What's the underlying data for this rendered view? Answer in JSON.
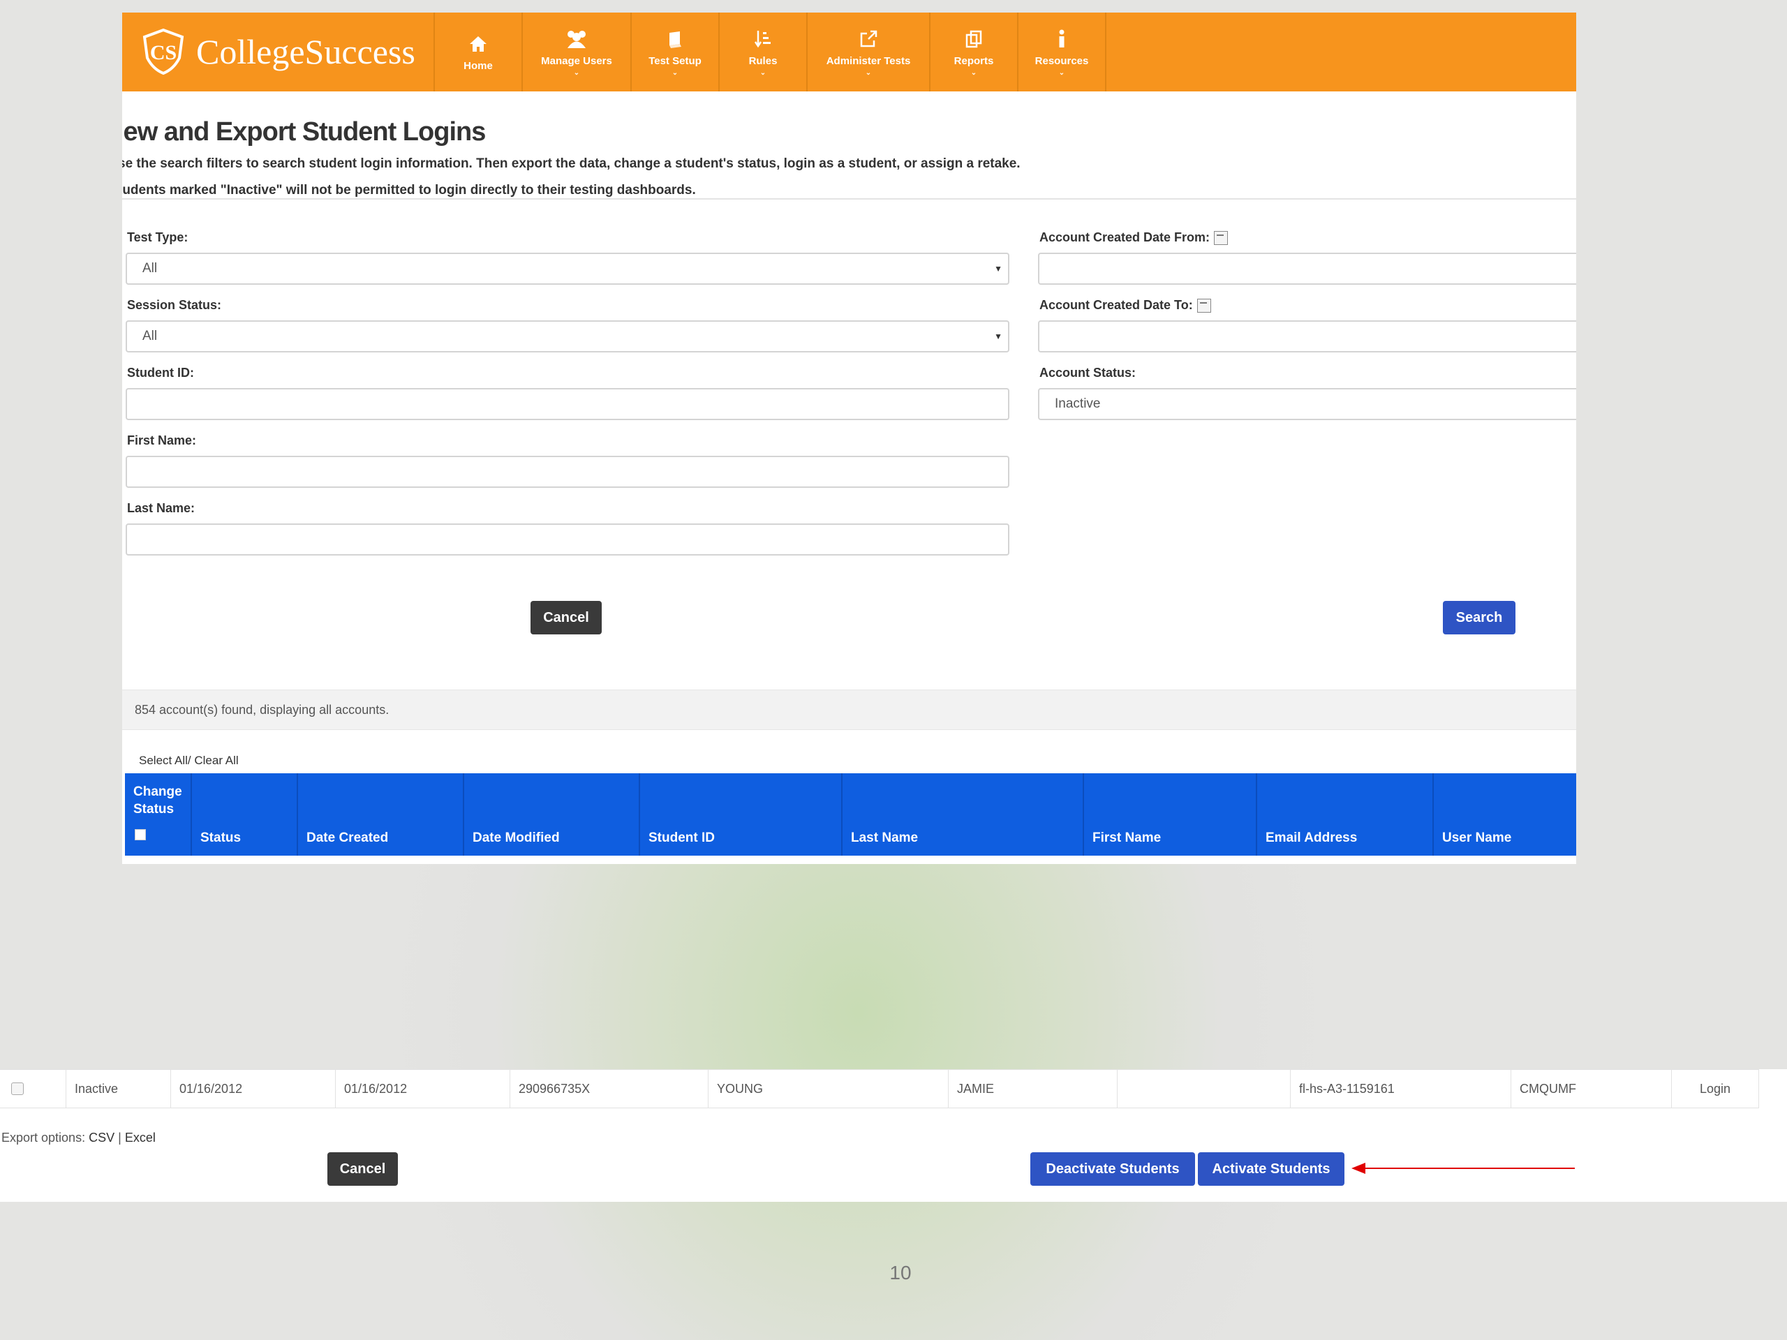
{
  "brand": {
    "name": "CollegeSuccess",
    "logo_icon": "cs-shield-logo"
  },
  "colors": {
    "nav": "#f7941d",
    "table_header": "#0f5ee0",
    "primary_button": "#2e54c4",
    "dark_button": "#3a3a3a",
    "arrow": "#e00000"
  },
  "nav": {
    "items": [
      {
        "label": "Home",
        "icon": "home-icon"
      },
      {
        "label": "Manage Users",
        "icon": "users-icon"
      },
      {
        "label": "Test Setup",
        "icon": "book-icon"
      },
      {
        "label": "Rules",
        "icon": "sort-icon"
      },
      {
        "label": "Administer Tests",
        "icon": "external-link-icon"
      },
      {
        "label": "Reports",
        "icon": "reports-icon"
      },
      {
        "label": "Resources",
        "icon": "info-icon"
      }
    ]
  },
  "page": {
    "title": "iew and Export Student Logins",
    "intro1": "se the search filters to search student login information. Then export the data, change a student's status, login as a student, or assign a retake.",
    "intro2": "tudents marked \"Inactive\" will not be permitted to login directly to their testing dashboards."
  },
  "filters": {
    "test_type": {
      "label": "Test Type:",
      "value": "All"
    },
    "session_status": {
      "label": "Session Status:",
      "value": "All"
    },
    "student_id": {
      "label": "Student ID:",
      "value": ""
    },
    "first_name": {
      "label": "First Name:",
      "value": ""
    },
    "last_name": {
      "label": "Last Name:",
      "value": ""
    },
    "created_from": {
      "label": "Account Created Date From:",
      "value": ""
    },
    "created_to": {
      "label": "Account Created Date To:",
      "value": ""
    },
    "account_status": {
      "label": "Account Status:",
      "value": "Inactive"
    }
  },
  "actions": {
    "cancel": "Cancel",
    "search": "Search"
  },
  "results": {
    "summary": "854 account(s) found, displaying all accounts.",
    "select_all": "Select All/ Clear All"
  },
  "table": {
    "headers": [
      "Change Status",
      "Status",
      "Date Created",
      "Date Modified",
      "Student ID",
      "Last Name",
      "First Name",
      "Email Address",
      "User Name"
    ],
    "rows": [
      {
        "status": "Inactive",
        "date_created": "01/16/2012",
        "date_modified": "01/16/2012",
        "student_id": "290966735X",
        "last_name": "YOUNG",
        "first_name": "JAMIE",
        "email": "",
        "username": "fl-hs-A3-1159161",
        "password": "CMQUMF",
        "action": "Login"
      }
    ]
  },
  "bottom": {
    "export_label": "Export options:",
    "export_csv": "CSV",
    "export_sep": "|",
    "export_excel": "Excel",
    "cancel": "Cancel",
    "deactivate": "Deactivate Students",
    "activate": "Activate Students"
  },
  "page_number": "10"
}
